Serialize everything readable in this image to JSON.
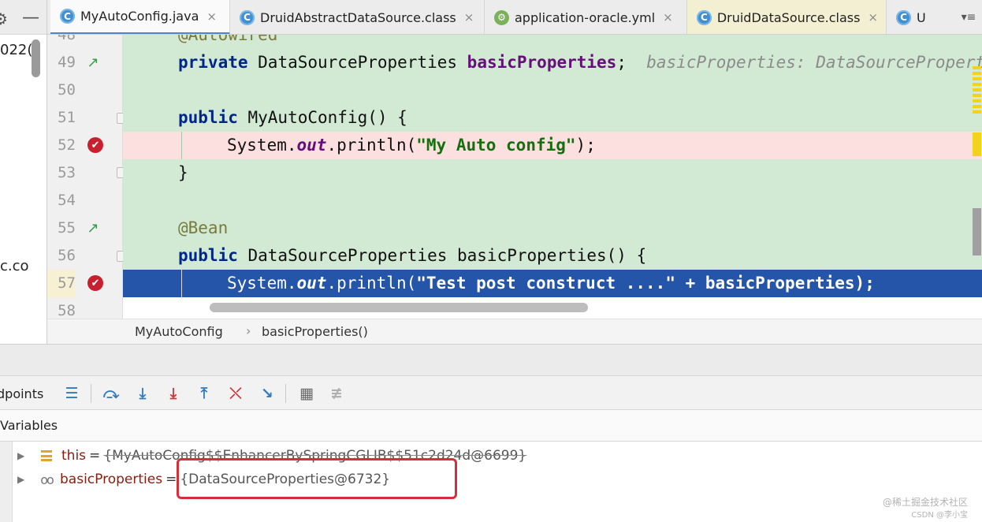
{
  "project_panel": {
    "partial_text_1": "022(",
    "partial_text_2": "c.co"
  },
  "tabs": [
    {
      "label": "MyAutoConfig.java",
      "icon": "class-icon",
      "active": true
    },
    {
      "label": "DruidAbstractDataSource.class",
      "icon": "class-icon",
      "active": false
    },
    {
      "label": "application-oracle.yml",
      "icon": "yml-icon",
      "active": false
    },
    {
      "label": "DruidDataSource.class",
      "icon": "class-icon",
      "active": false
    },
    {
      "label": "U",
      "icon": "class-icon",
      "active": false
    }
  ],
  "tab_icon_letter": "C",
  "tab_close_glyph": "×",
  "tab_menu_glyph": "▾≡",
  "editor": {
    "lines": [
      {
        "num": "48",
        "text": "@Autowired"
      },
      {
        "num": "49",
        "text_kw": "private",
        "text_type": " DataSourceProperties ",
        "text_field": "basicProperties",
        "text_end": ";  ",
        "hint": "basicProperties: DataSourceProperties"
      },
      {
        "num": "50"
      },
      {
        "num": "51",
        "text_kw": "public",
        "text_rest": " MyAutoConfig() {"
      },
      {
        "num": "52",
        "text_a": "System.",
        "text_ital": "out",
        "text_b": ".println(",
        "text_str": "\"My Auto config\"",
        "text_c": ");"
      },
      {
        "num": "53",
        "text": "}"
      },
      {
        "num": "54"
      },
      {
        "num": "55",
        "text": "@Bean"
      },
      {
        "num": "56",
        "text_kw": "public",
        "text_rest": " DataSourceProperties basicProperties() {"
      },
      {
        "num": "57",
        "text_a": "System.",
        "text_ital": "out",
        "text_b": ".println(",
        "text_str": "\"Test post construct ....\"",
        "text_c": " + basicProperties);"
      },
      {
        "num": "58"
      }
    ],
    "breakpoint_glyph": "✔",
    "impl_glyph": "↗"
  },
  "breadcrumb": {
    "items": [
      "MyAutoConfig",
      "basicProperties()"
    ],
    "separator": "›"
  },
  "debug": {
    "toolbar_label": "dpoints",
    "tools": [
      {
        "name": "show-execution-point-icon",
        "glyph": "☰"
      },
      {
        "name": "step-over-icon",
        "glyph": "⤼"
      },
      {
        "name": "step-into-icon",
        "glyph": "⤓"
      },
      {
        "name": "force-step-into-icon",
        "glyph": "⤓"
      },
      {
        "name": "step-out-icon",
        "glyph": "⤒"
      },
      {
        "name": "drop-frame-icon",
        "glyph": "⤬"
      },
      {
        "name": "run-to-cursor-icon",
        "glyph": "↘"
      },
      {
        "name": "evaluate-expression-icon",
        "glyph": "▦"
      },
      {
        "name": "trace-icon",
        "glyph": "≢"
      }
    ],
    "variables_title": "Variables",
    "variables": [
      {
        "name": "this",
        "eq": "=",
        "value": "{MyAutoConfig$$EnhancerBySpringCGLIB$$51c2d24d@6699}",
        "icon": "field-lines-icon"
      },
      {
        "name": "basicProperties",
        "eq": "=",
        "value": "{DataSourceProperties@6732}",
        "icon": "watch-glasses-icon"
      }
    ],
    "expand_glyph": "▶",
    "glasses_glyph": "oo"
  },
  "watermark": {
    "line1": "@稀土掘金技术社区",
    "line2": "CSDN @李小宝"
  },
  "colors": {
    "added_line_bg": "#d2ead4",
    "breakpoint_line_bg": "#fbe0df",
    "current_line_bg": "#2455a8",
    "keyword": "#00268a",
    "string": "#166e0f",
    "highlight_box": "#d3303a"
  }
}
